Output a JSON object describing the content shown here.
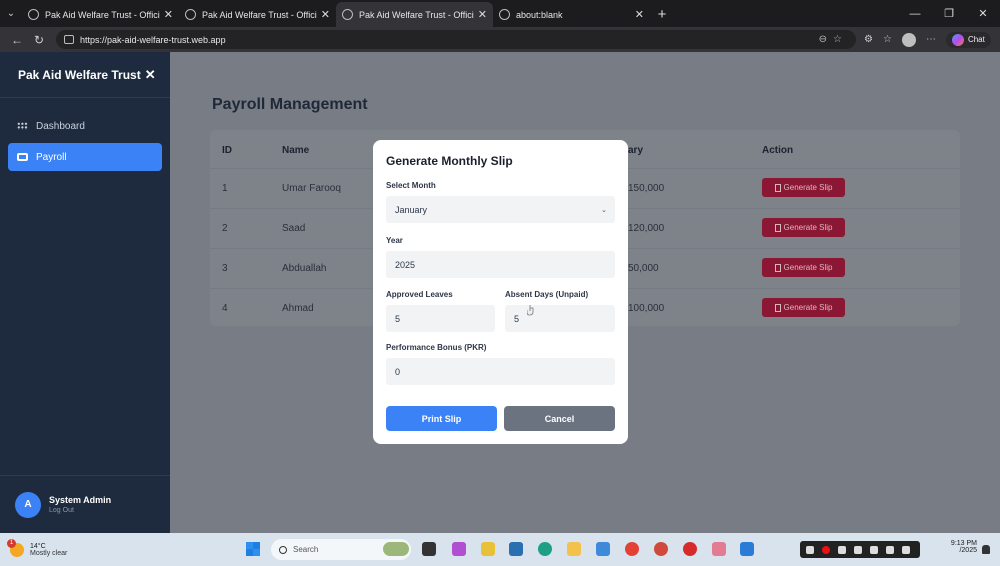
{
  "browser": {
    "tabs": [
      {
        "title": "Pak Aid Welfare Trust - Official Cli",
        "active": false
      },
      {
        "title": "Pak Aid Welfare Trust - Official Cli",
        "active": false
      },
      {
        "title": "Pak Aid Welfare Trust - Official Cli",
        "active": true
      },
      {
        "title": "about:blank",
        "active": false
      }
    ],
    "url": "https://pak-aid-welfare-trust.web.app",
    "copilot_label": "Chat"
  },
  "sidebar": {
    "brand": "Pak Aid Welfare Trust",
    "close_glyph": "✕",
    "items": [
      {
        "label": "Dashboard",
        "icon": "grid-icon",
        "active": false
      },
      {
        "label": "Payroll",
        "icon": "payroll-icon",
        "active": true
      }
    ],
    "user": {
      "initial": "A",
      "name": "System Admin",
      "action": "Log Out"
    }
  },
  "main": {
    "title": "Payroll Management",
    "table": {
      "headers": {
        "id": "ID",
        "name": "Name",
        "salary": "ary",
        "action": "Action"
      },
      "rows": [
        {
          "id": "1",
          "name": "Umar Farooq",
          "salary": "150,000",
          "action": "Generate Slip"
        },
        {
          "id": "2",
          "name": "Saad",
          "salary": "120,000",
          "action": "Generate Slip"
        },
        {
          "id": "3",
          "name": "Abduallah",
          "salary": "50,000",
          "action": "Generate Slip"
        },
        {
          "id": "4",
          "name": "Ahmad",
          "salary": "100,000",
          "action": "Generate Slip"
        }
      ]
    }
  },
  "modal": {
    "title": "Generate Monthly Slip",
    "month_label": "Select Month",
    "month_value": "January",
    "year_label": "Year",
    "year_value": "2025",
    "leaves_label": "Approved Leaves",
    "leaves_value": "5",
    "absent_label": "Absent Days (Unpaid)",
    "absent_value": "5",
    "bonus_label": "Performance Bonus (PKR)",
    "bonus_value": "0",
    "print_label": "Print Slip",
    "cancel_label": "Cancel"
  },
  "taskbar": {
    "weather_temp": "14°C",
    "weather_cond": "Mostly clear",
    "notif_count": "1",
    "search_placeholder": "Search",
    "time": "9:13 PM",
    "date": "/2025"
  },
  "colors": {
    "accent": "#3b82f6",
    "sidebar_bg": "#1e2b3e",
    "danger": "#8a1834",
    "cancel": "#6b7280"
  }
}
